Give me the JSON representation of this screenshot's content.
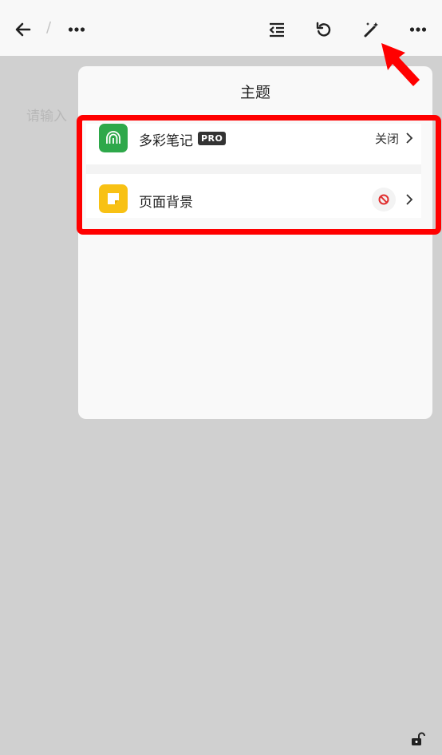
{
  "toolbar": {
    "separator": "/",
    "icons": [
      "back-arrow-icon",
      "more-icon",
      "outdent-icon",
      "undo-icon",
      "magic-wand-icon",
      "more-icon"
    ]
  },
  "editor": {
    "placeholder": "请输入"
  },
  "panel": {
    "title": "主题",
    "rows": [
      {
        "icon": "fingerprint-icon",
        "icon_color": "#2ea84a",
        "label": "多彩笔记",
        "badge": "PRO",
        "value": "关闭"
      },
      {
        "icon": "note-icon",
        "icon_color": "#f8c114",
        "label": "页面背景",
        "value_icon": "no-entry-icon"
      }
    ]
  },
  "colors": {
    "highlight": "#ff0000",
    "overlay": "#d0d0d0",
    "panel": "#f9f9f9"
  },
  "footer": {
    "icon": "unlock-icon"
  }
}
